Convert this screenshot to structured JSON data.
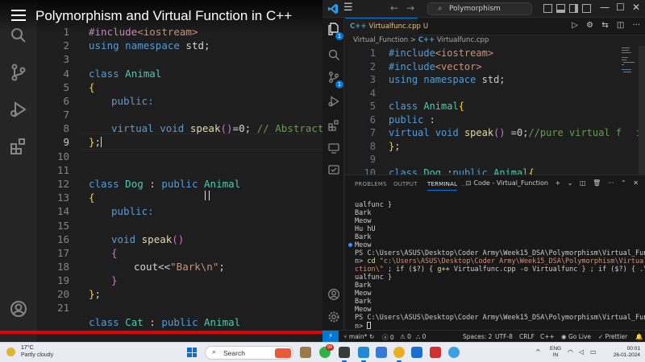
{
  "video": {
    "title": "Polymorphism and Virtual Function in C++",
    "progress_fraction": 1.0,
    "line_numbers": [
      "1",
      "2",
      "3",
      "4",
      "5",
      "6",
      "7",
      "8",
      "9",
      "10",
      "11",
      "12",
      "13",
      "14",
      "15",
      "16",
      "17",
      "18",
      "19",
      "20",
      "21"
    ],
    "active_line": "9",
    "code": {
      "l1_pp": "#include",
      "l1_inc": "<iostream>",
      "l2_kw1": "using",
      "l2_kw2": "namespace",
      "l2_rest": " std;",
      "l4_kw": "class",
      "l4_ty": "Animal",
      "l5_br": "{",
      "l6_kw": "public:",
      "l8_kw1": "virtual",
      "l8_kw2": "void",
      "l8_fn": "speak",
      "l8_par": "()",
      "l8_rest": "=0; ",
      "l8_cm": "// Abstract cl",
      "l9_br": "}",
      "l9_rest": ";",
      "l12_kw": "class",
      "l12_ty": "Dog",
      "l12_mid": " : ",
      "l12_kw2": "public",
      "l12_ty2": "Animal",
      "l13_br": "{",
      "l14_kw": "public:",
      "l16_kw": "void",
      "l16_fn": "speak",
      "l16_par": "()",
      "l17_br": "{",
      "l18_pre": "cout<<",
      "l18_st": "\"Bark\\n\"",
      "l18_rest": ";",
      "l19_br": "}",
      "l20_br": "}",
      "l20_rest": ";",
      "l22_kw": "class",
      "l22_ty": "Cat",
      "l22_mid": " : ",
      "l22_kw2": "public",
      "l22_ty2": "Animal"
    }
  },
  "vscode": {
    "search_text": "Polymorphism",
    "tab": {
      "label": "Virtualfunc.cpp",
      "modified": "U",
      "lang": "C++"
    },
    "breadcrumb": {
      "folder": "Virtual_Function",
      "sep": ">",
      "file": "Virtualfunc.cpp",
      "lang": "C++"
    },
    "explorer_badge": "1",
    "scm_badge": "1",
    "editor_line_numbers": [
      "1",
      "2",
      "3",
      "4",
      "5",
      "6",
      "7",
      "8",
      "9",
      "10"
    ],
    "editor": {
      "l1_pp": "#include",
      "l1_inc": "<iostream>",
      "l2_pp": "#include",
      "l2_inc": "<vector>",
      "l3_kw1": "using",
      "l3_kw2": "namespace",
      "l3_rest": " std;",
      "l5_kw": "class",
      "l5_ty": "Animal",
      "l5_br": "{",
      "l6_kw": "public",
      "l6_rest": " :",
      "l7_kw1": "virtual",
      "l7_kw2": "void",
      "l7_fn": "speak",
      "l7_par": "()",
      "l7_rest": " =0;",
      "l7_cm": "//pure virtual func",
      "l8_br": "}",
      "l8_rest": ";",
      "l10_kw": "class",
      "l10_ty": "Dog",
      "l10_mid": " :",
      "l10_kw2": "public",
      "l10_ty2": "Animal",
      "l10_br": "{"
    },
    "panel": {
      "tabs": [
        "PROBLEMS",
        "OUTPUT",
        "TERMINAL"
      ],
      "active_tab": "TERMINAL",
      "more": "...",
      "terminal_name": "Code - Virtual_Function"
    },
    "terminal": {
      "l1": "ualfunc }",
      "l2": "Bark",
      "l3": "Meow",
      "l4": "Hu hU",
      "l5": "Bark",
      "l6": "Meow",
      "l7": "PS C:\\Users\\ASUS\\Desktop\\Coder Army\\Week15_DSA\\Polymorphism\\Virtual_Functio",
      "l8_a": "n> ",
      "l8_cmd": "cd",
      "l8_str": " \"c:\\Users\\ASUS\\Desktop\\Coder Army\\Week15_DSA\\Polymorphism\\Virtual_Fun",
      "l9_str": "ction\\\"",
      "l9_rest": " ; if ($?) { ",
      "l9_cmd": "g++",
      "l9_rest2": " Virtualfunc.cpp -o Virtualfunc } ; if ($?) { .\\Virt",
      "l10": "ualfunc }",
      "l11": "Bark",
      "l12": "Meow",
      "l13": "Bark",
      "l14": "Meow",
      "l15": "PS C:\\Users\\ASUS\\Desktop\\Coder Army\\Week15_DSA\\Polymorphism\\Virtual_Functio",
      "l16": "n> "
    },
    "status": {
      "branch": "main*",
      "sync": "↻",
      "errors": "ⓧ 0",
      "warnings": "⚠ 0",
      "ports": "὚ 0",
      "spaces": "Spaces: 2",
      "encoding": "UTF-8",
      "eol": "CRLF",
      "language": "C++",
      "golive": "Go Live",
      "prettier": "Prettier"
    }
  },
  "taskbar": {
    "weather_temp": "17°C",
    "weather_desc": "Partly cloudy",
    "search_label": "Search",
    "whatsapp_badge": "99",
    "lang_1": "ENG",
    "lang_2": "IN",
    "time": "00:01",
    "date": "26-01-2024"
  },
  "colors": {
    "accent": "#0078d4",
    "progress": "#e60000",
    "keyword": "#569cd6",
    "type": "#4ec9b0",
    "function": "#dcdcaa",
    "string": "#ce9178",
    "comment": "#6a9955"
  }
}
